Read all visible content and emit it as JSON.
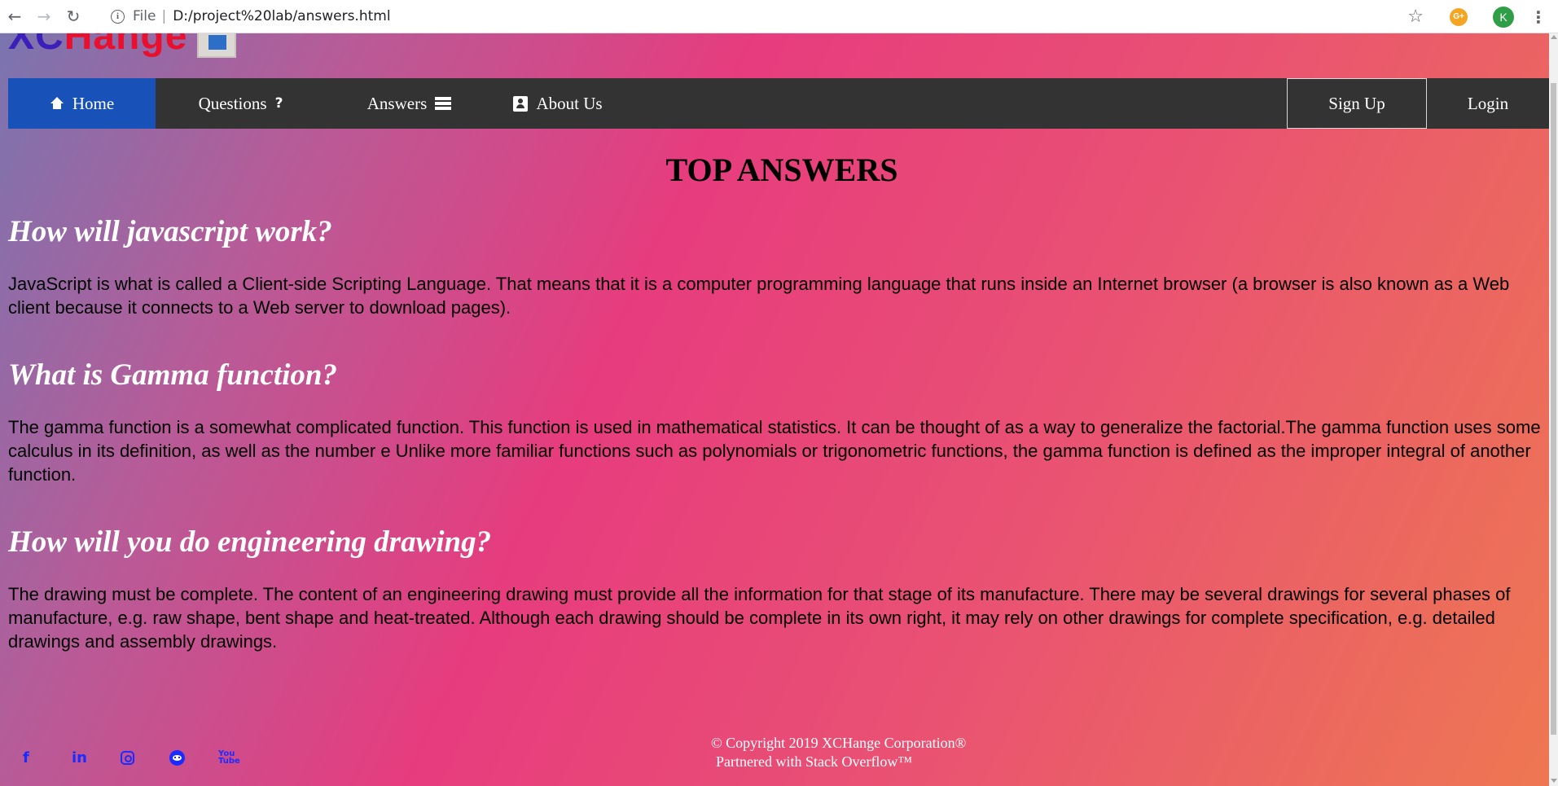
{
  "browser": {
    "back_icon": "←",
    "forward_icon": "→",
    "reload_icon": "↻",
    "file_label": "File",
    "url": "D:/project%20lab/answers.html",
    "star_icon": "☆",
    "extension_label": "G+",
    "profile_initial": "K",
    "menu_icon": "⋮"
  },
  "site": {
    "logo_xc": "XC",
    "logo_hange": "Hange"
  },
  "nav": {
    "home": "Home",
    "questions": "Questions",
    "questions_icon": "?",
    "answers": "Answers",
    "about": "About Us",
    "signup": "Sign Up",
    "login": "Login"
  },
  "main": {
    "title": "TOP ANSWERS",
    "answers": [
      {
        "question": "How will javascript work?",
        "answer": "JavaScript is what is called a Client-side Scripting Language. That means that it is a computer programming language that runs inside an Internet browser (a browser is also known as a Web client because it connects to a Web server to download pages)."
      },
      {
        "question": "What is Gamma function?",
        "answer": "The gamma function is a somewhat complicated function. This function is used in mathematical statistics. It can be thought of as a way to generalize the factorial.The gamma function uses some calculus in its definition, as well as the number e Unlike more familiar functions such as polynomials or trigonometric functions, the gamma function is defined as the improper integral of another function."
      },
      {
        "question": "How will you do engineering drawing?",
        "answer": "The drawing must be complete. The content of an engineering drawing must provide all the information for that stage of its manufacture. There may be several drawings for several phases of manufacture, e.g. raw shape, bent shape and heat-treated. Although each drawing should be complete in its own right, it may rely on other drawings for complete specification, e.g. detailed drawings and assembly drawings."
      }
    ]
  },
  "footer": {
    "social": {
      "facebook": "f",
      "linkedin": "in",
      "youtube_top": "You",
      "youtube_bottom": "Tube"
    },
    "copyright": "© Copyright 2019 XCHange Corporation®",
    "partner": "Partnered with Stack Overflow™"
  },
  "colors": {
    "navbar_bg": "#333333",
    "nav_active_bg": "#1851b7",
    "social_icon": "#1a2bff",
    "gradient": [
      "#7a75b0",
      "#e73c7e",
      "#ee7752"
    ]
  }
}
